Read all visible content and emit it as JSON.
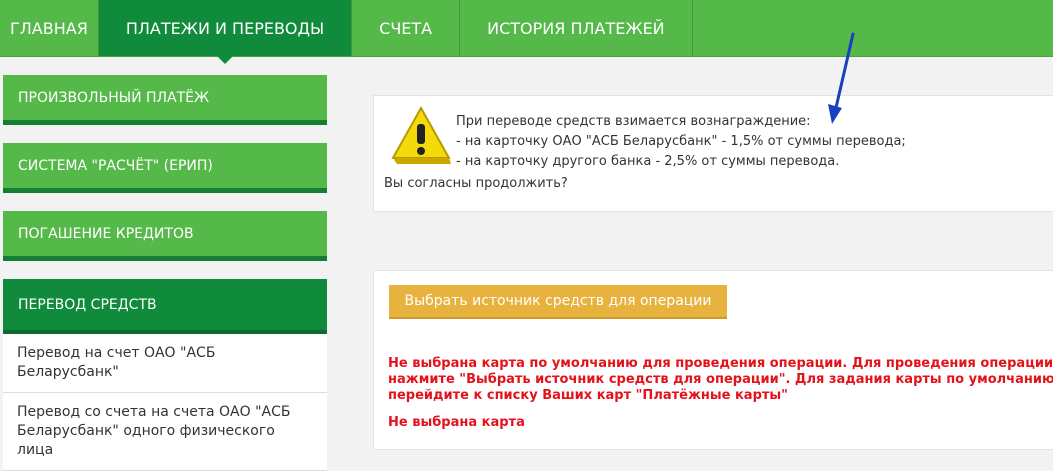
{
  "nav": {
    "tabs": [
      {
        "label": "ГЛАВНАЯ"
      },
      {
        "label": "ПЛАТЕЖИ И ПЕРЕВОДЫ"
      },
      {
        "label": "СЧЕТА"
      },
      {
        "label": "ИСТОРИЯ ПЛАТЕЖЕЙ"
      }
    ]
  },
  "sidebar": {
    "items": [
      {
        "label": "ПРОИЗВОЛЬНЫЙ ПЛАТЁЖ"
      },
      {
        "label": "СИСТЕМА \"РАСЧЁТ\" (ЕРИП)"
      },
      {
        "label": "ПОГАШЕНИЕ КРЕДИТОВ"
      },
      {
        "label": "ПЕРЕВОД СРЕДСТВ"
      }
    ],
    "sub_items": [
      {
        "label": "Перевод на счет ОАО \"АСБ Беларусбанк\""
      },
      {
        "label": "Перевод со счета на счета ОАО \"АСБ Беларусбанк\" одного физического лица"
      }
    ]
  },
  "notice": {
    "line1": "При переводе средств взимается вознаграждение:",
    "line2": "- на карточку ОАО \"АСБ Беларусбанк\" - 1,5% от суммы перевода;",
    "line3": "- на карточку другого банка - 2,5% от суммы перевода.",
    "question": "Вы согласны продолжить?",
    "icon": "warning-icon"
  },
  "panel": {
    "button_label": "Выбрать источник средств для операции",
    "error_line1": "Не выбрана карта по умолчанию для проведения операции. Для проведения операции",
    "error_line2": "нажмите \"Выбрать источник средств для операции\". Для задания карты по умолчанию",
    "error_line3": "перейдите к списку Ваших карт \"Платёжные карты\"",
    "error2": "Не выбрана карта"
  },
  "colors": {
    "nav_green": "#55b94a",
    "active_green": "#0f8b3b",
    "button_orange": "#e8b23e",
    "error_red": "#e3121b",
    "arrow_blue": "#1a3fbf"
  }
}
